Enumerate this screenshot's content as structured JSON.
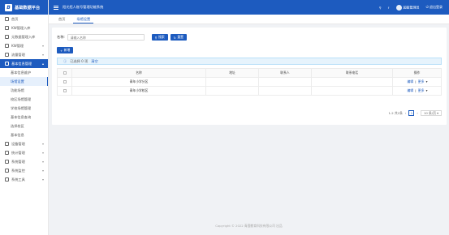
{
  "app": {
    "name": "基础数据平台",
    "logo_glyph": "B"
  },
  "header": {
    "title": "阳光招人账号管理功能系统",
    "icons": [
      "search-icon",
      "bell-icon"
    ],
    "user": "超级管理员",
    "logout": "退出登录"
  },
  "tabs": [
    {
      "label": "首页"
    },
    {
      "label": "场馆设置"
    }
  ],
  "sidebar": {
    "items": [
      {
        "label": "首页",
        "icon": "home-icon"
      },
      {
        "label": "KW管理入库",
        "icon": "monitor-icon"
      },
      {
        "label": "元数据管理入库",
        "icon": "monitor-icon"
      },
      {
        "label": "KW管理",
        "icon": "file-icon",
        "arrow": "▾"
      },
      {
        "label": "流量管理",
        "icon": "grid-icon",
        "arrow": "▾"
      },
      {
        "label": "基本信息管理",
        "icon": "box-icon",
        "arrow": "▴",
        "active": true
      }
    ],
    "sub_items": [
      {
        "label": "基本信息维护"
      },
      {
        "label": "场馆设置",
        "current": true
      },
      {
        "label": "功能场馆"
      },
      {
        "label": "校区场馆管理"
      },
      {
        "label": "学校场馆管理"
      },
      {
        "label": "基本信息查询"
      },
      {
        "label": "选择校区"
      },
      {
        "label": "基本信息"
      }
    ],
    "items_after": [
      {
        "label": "设备管理",
        "icon": "tool-icon",
        "arrow": "▾"
      },
      {
        "label": "统计管理",
        "icon": "chart-icon",
        "arrow": "▾"
      },
      {
        "label": "系统管理",
        "icon": "gear-icon",
        "arrow": "▾"
      },
      {
        "label": "系统监控",
        "icon": "eye-icon",
        "arrow": "▾"
      },
      {
        "label": "系统工具",
        "icon": "wrench-icon",
        "arrow": "▾"
      }
    ]
  },
  "search": {
    "label": "名称:",
    "placeholder": "请输入名称",
    "search_btn": "搜索",
    "reset_btn": "重置"
  },
  "add_btn": "新增",
  "alert": {
    "text": "已选择 0 项",
    "clear": "清空"
  },
  "table": {
    "columns": [
      "",
      "名称",
      "地址",
      "联系人",
      "联系电话",
      "操作"
    ],
    "rows": [
      {
        "name": "青年小学分区",
        "address": "",
        "contact": "",
        "phone": "",
        "edit": "编辑",
        "more": "更多"
      },
      {
        "name": "青年小学校区",
        "address": "",
        "contact": "",
        "phone": "",
        "edit": "编辑",
        "more": "更多"
      }
    ]
  },
  "pager": {
    "total": "1-2 共2条",
    "prev": "‹",
    "page": "1",
    "next": "›",
    "size": "10 条/页"
  },
  "footer": "Copyright © 2022 青鹿教育科技有限公司 出品"
}
